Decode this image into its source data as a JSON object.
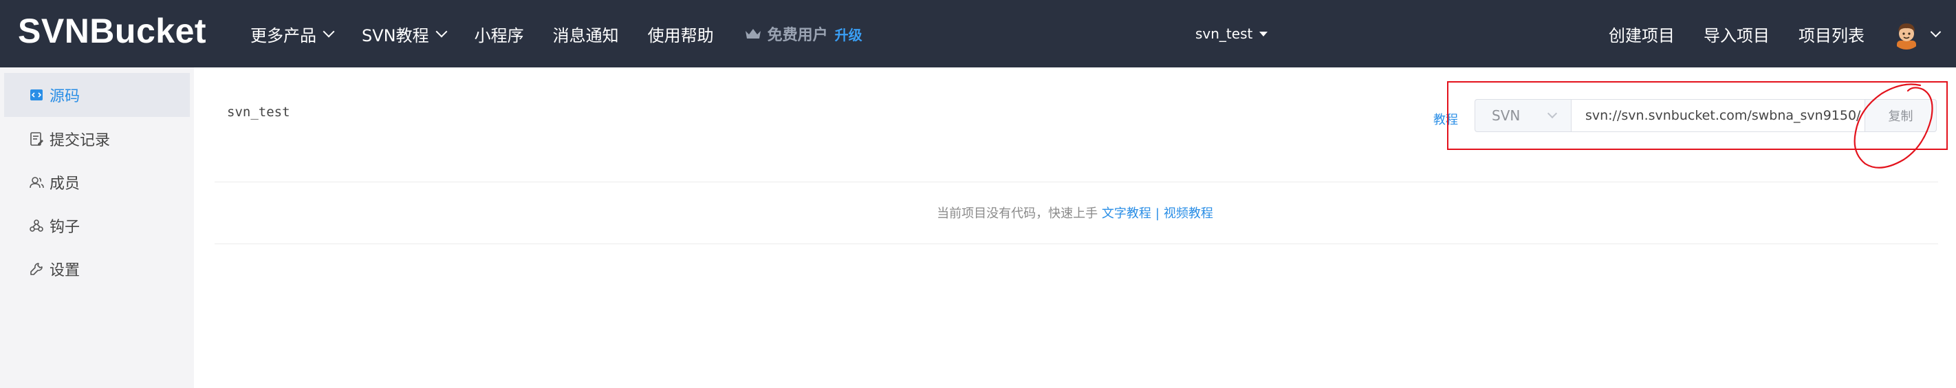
{
  "header": {
    "logo": "SVNBucket",
    "nav": [
      {
        "label": "更多产品",
        "dropdown": true
      },
      {
        "label": "SVN教程",
        "dropdown": true
      },
      {
        "label": "小程序",
        "dropdown": false
      },
      {
        "label": "消息通知",
        "dropdown": false
      },
      {
        "label": "使用帮助",
        "dropdown": false
      }
    ],
    "free_user_label": "免费用户",
    "upgrade_label": "升级",
    "project_selector": "svn_test",
    "right_nav": [
      "创建项目",
      "导入项目",
      "项目列表"
    ]
  },
  "sidebar": {
    "items": [
      {
        "label": "源码",
        "icon": "code-icon",
        "active": true
      },
      {
        "label": "提交记录",
        "icon": "commit-log-icon",
        "active": false
      },
      {
        "label": "成员",
        "icon": "members-icon",
        "active": false
      },
      {
        "label": "钩子",
        "icon": "webhook-icon",
        "active": false
      },
      {
        "label": "设置",
        "icon": "settings-icon",
        "active": false
      }
    ]
  },
  "main": {
    "repo_name": "svn_test",
    "tutorial_link": "教程",
    "vcs_type": "SVN",
    "repo_url": "svn://svn.svnbucket.com/swbna_svn9150/",
    "copy_label": "复制",
    "empty_message": "当前项目没有代码，快速上手",
    "text_tutorial": "文字教程",
    "separator": "|",
    "video_tutorial": "视频教程"
  },
  "colors": {
    "header_bg": "#2a3140",
    "accent": "#2a8ee6",
    "annotation": "#e3121c"
  }
}
